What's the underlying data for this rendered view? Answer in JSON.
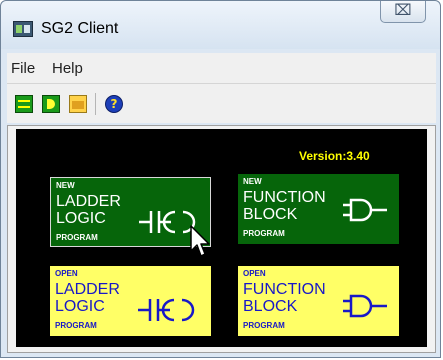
{
  "window": {
    "title": "SG2 Client",
    "close_symbol": "⌧"
  },
  "menu": {
    "file": "File",
    "help": "Help"
  },
  "toolbar": {
    "help_glyph": "?"
  },
  "main": {
    "version": "Version:3.40",
    "tiles": [
      {
        "tag": "NEW",
        "line1": "LADDER",
        "line2": "LOGIC",
        "sub": "PROGRAM",
        "icon": "ladder-contact-coil-icon"
      },
      {
        "tag": "NEW",
        "line1": "FUNCTION",
        "line2": "BLOCK",
        "sub": "PROGRAM",
        "icon": "function-block-gate-icon"
      },
      {
        "tag": "OPEN",
        "line1": "LADDER",
        "line2": "LOGIC",
        "sub": "PROGRAM",
        "icon": "ladder-contact-coil-icon"
      },
      {
        "tag": "OPEN",
        "line1": "FUNCTION",
        "line2": "BLOCK",
        "sub": "PROGRAM",
        "icon": "function-block-gate-icon"
      }
    ]
  },
  "colors": {
    "new_tile": "#06650a",
    "open_tile": "#ffff66",
    "version": "#ffff00",
    "background": "#000000"
  }
}
